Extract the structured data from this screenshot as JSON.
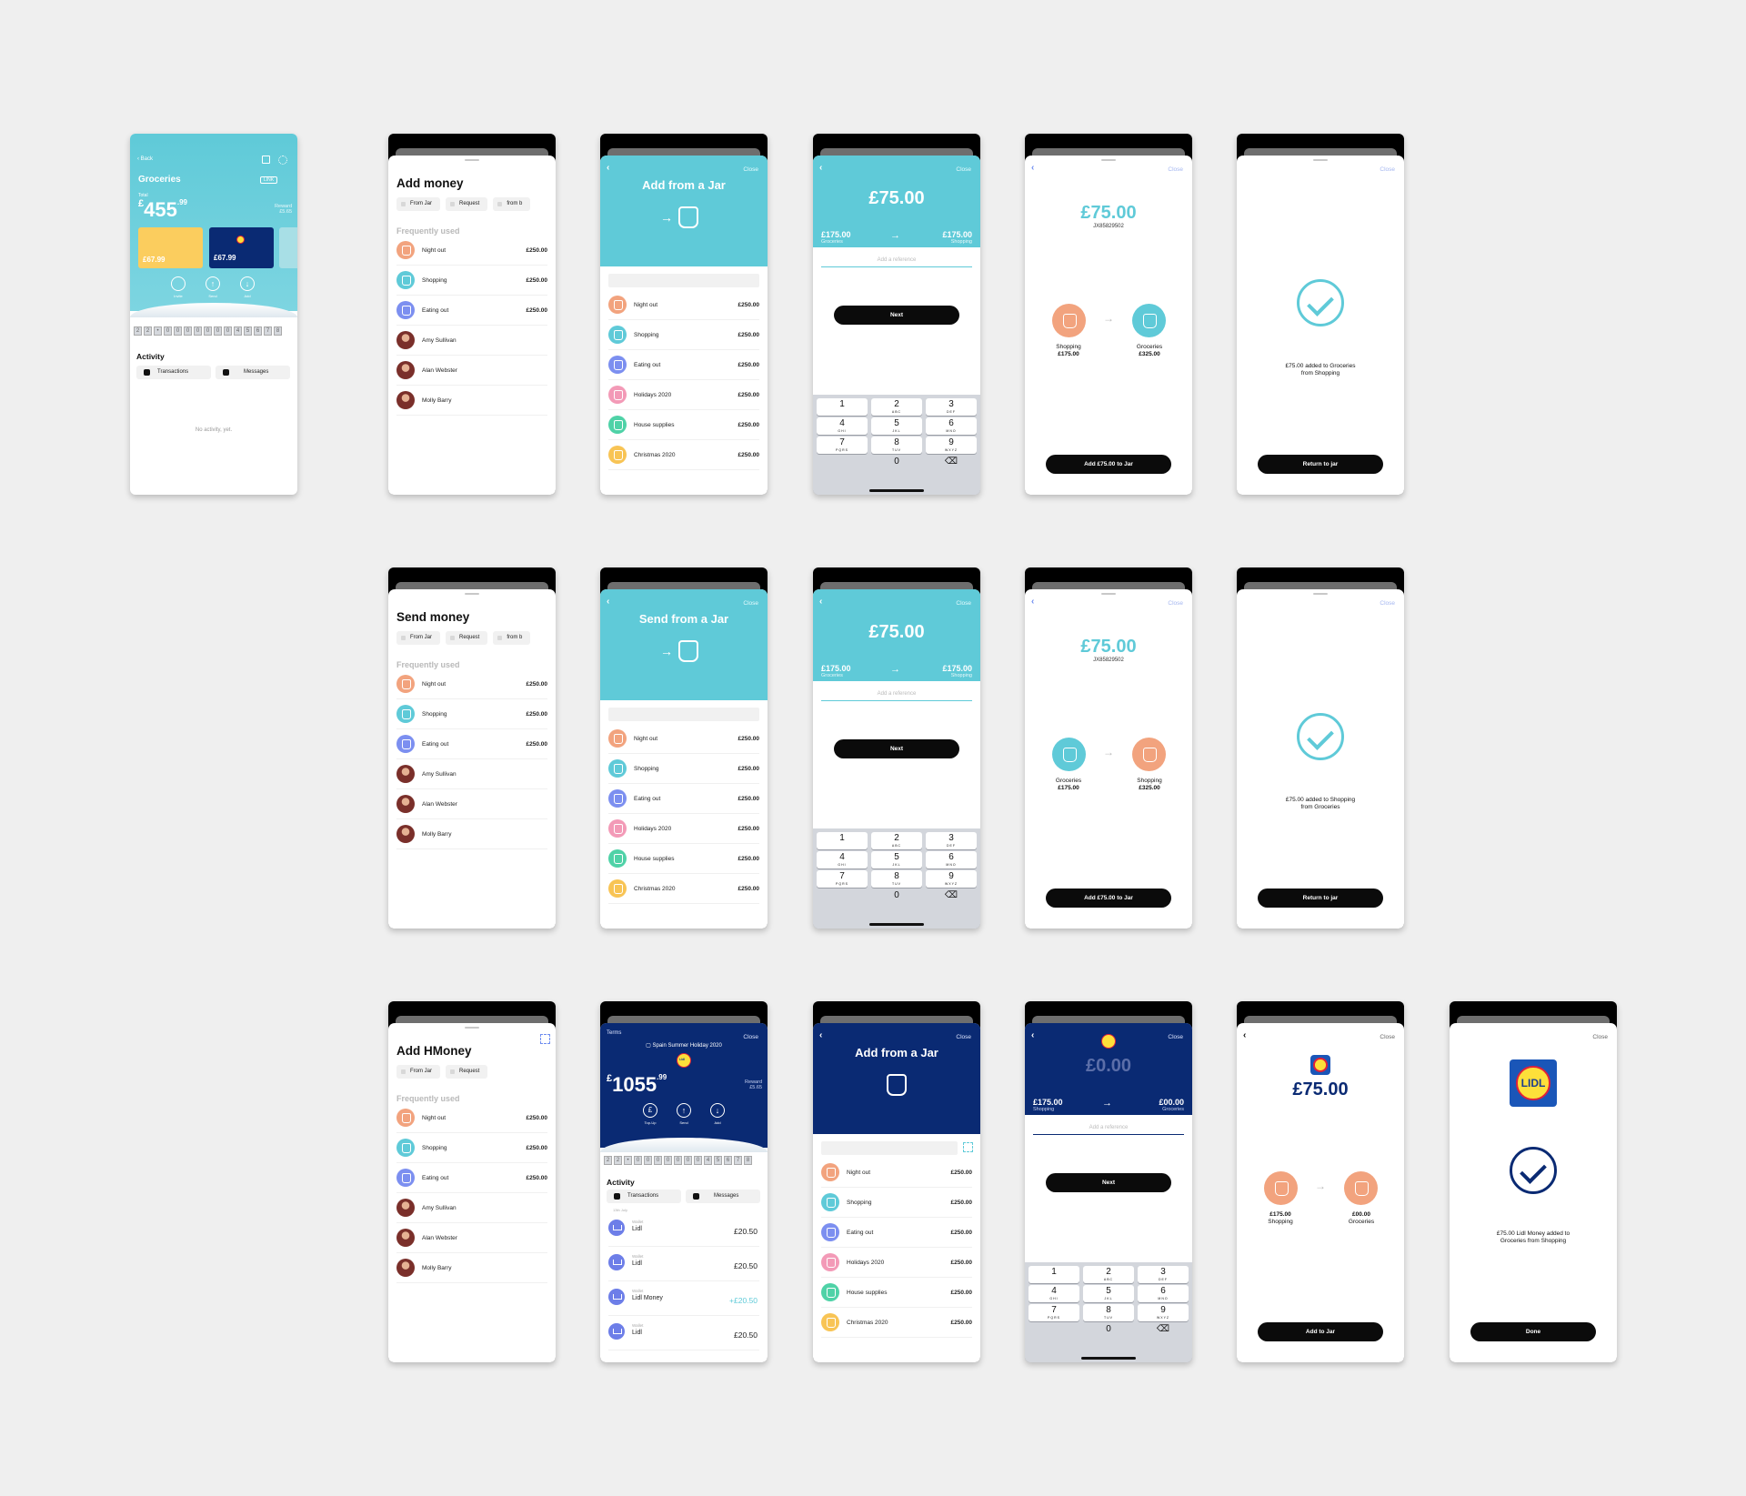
{
  "common": {
    "close": "Close",
    "frequently_used": "Frequently used",
    "from_jar": "From Jar",
    "request": "Request",
    "from_bank": "from b",
    "next": "Next",
    "reference_placeholder": "Add a reference",
    "jar_rows": [
      {
        "label": "Night out",
        "value": "£250.00",
        "color": "#f2a37e"
      },
      {
        "label": "Shopping",
        "value": "£250.00",
        "color": "#5fcad8"
      },
      {
        "label": "Eating out",
        "value": "£250.00",
        "color": "#7c8ff0"
      },
      {
        "label": "Holidays 2020",
        "value": "£250.00",
        "color": "#f39ab7"
      },
      {
        "label": "House supplies",
        "value": "£250.00",
        "color": "#4fd2a7"
      },
      {
        "label": "Christmas 2020",
        "value": "£250.00",
        "color": "#f8c455"
      }
    ],
    "contacts": [
      "Amy Sullivan",
      "Alan Webster",
      "Molly Barry"
    ],
    "keys": [
      {
        "n": "1",
        "l": ""
      },
      {
        "n": "2",
        "l": "ABC"
      },
      {
        "n": "3",
        "l": "DEF"
      },
      {
        "n": "4",
        "l": "GHI"
      },
      {
        "n": "5",
        "l": "JKL"
      },
      {
        "n": "6",
        "l": "MNO"
      },
      {
        "n": "7",
        "l": "PQRS"
      },
      {
        "n": "8",
        "l": "TUV"
      },
      {
        "n": "9",
        "l": "WXYZ"
      },
      {
        "n": "0",
        "l": ""
      }
    ],
    "ticket_digits": [
      "2",
      "2",
      "•",
      "0",
      "0",
      "0",
      "0",
      "0",
      "0",
      "0",
      "4",
      "5",
      "6",
      "7",
      "8"
    ]
  },
  "s1": {
    "back": "Back",
    "title": "Groceries",
    "link": "LINK",
    "total_label": "Total",
    "currency": "£",
    "amount": "455",
    "amount_dec": ".99",
    "reward_label": "Reward",
    "reward_value": "£5.65",
    "card1": "£67.99",
    "card2": "£67.99",
    "action_invite": "Invite",
    "action_send": "Send",
    "action_add": "Add",
    "activity": "Activity",
    "tab_transactions": "Transactions",
    "tab_messages": "Messages",
    "empty": "No activity, yet."
  },
  "s2": {
    "title": "Add money"
  },
  "s3": {
    "title": "Add from a Jar"
  },
  "s4": {
    "amount": "£75.00",
    "from_value": "£175.00",
    "from_label": "Groceries",
    "to_value": "£175.00",
    "to_label": "Shopping"
  },
  "s5": {
    "amount": "£75.00",
    "ref": "JX85829502",
    "from_label": "Shopping",
    "from_value": "£175.00",
    "to_label": "Groceries",
    "to_value": "£325.00",
    "button": "Add £75.00 to Jar"
  },
  "s6": {
    "message1": "£75.00 added to Groceries",
    "message2": "from Shopping",
    "button": "Return to jar"
  },
  "s7": {
    "title": "Send money"
  },
  "s8": {
    "title": "Send from a Jar"
  },
  "s9": {
    "amount": "£75.00",
    "from_value": "£175.00",
    "from_label": "Groceries",
    "to_value": "£175.00",
    "to_label": "Shopping"
  },
  "s10": {
    "amount": "£75.00",
    "ref": "JX85829502",
    "from_label": "Groceries",
    "from_value": "£175.00",
    "to_label": "Shopping",
    "to_value": "£325.00",
    "button": "Add £75.00 to Jar"
  },
  "s11": {
    "message1": "£75.00 added to Shopping",
    "message2": "from Groceries",
    "button": "Return to jar"
  },
  "s12": {
    "title": "Add HMoney"
  },
  "s13": {
    "terms": "Terms",
    "jar_name": "Spain Summer Holiday 2020",
    "logo_text": "Lidl",
    "currency": "£",
    "amount": "1055",
    "amount_dec": ".99",
    "reward_label": "Reward",
    "reward_value": "£5.65",
    "action_topup": "Top-Up",
    "action_send": "Send",
    "action_add": "Add",
    "activity": "Activity",
    "tab_transactions": "Transactions",
    "tab_messages": "Messages",
    "date": "13th July",
    "tx": [
      {
        "sub": "Wallet",
        "label": "Lidl",
        "value": "£20.50",
        "pos": false
      },
      {
        "sub": "Wallet",
        "label": "Lidl",
        "value": "£20.50",
        "pos": false
      },
      {
        "sub": "Wallet",
        "label": "Lidl Money",
        "value": "+£20.50",
        "pos": true
      },
      {
        "sub": "Wallet",
        "label": "Lidl",
        "value": "£20.50",
        "pos": false
      }
    ]
  },
  "s14": {
    "title": "Add from a Jar"
  },
  "s15": {
    "amount": "£0.00",
    "from_value": "£175.00",
    "from_label": "Shopping",
    "to_value": "£00.00",
    "to_label": "Groceries"
  },
  "s16": {
    "amount": "£75.00",
    "from_value": "£175.00",
    "from_label": "Shopping",
    "to_value": "£00.00",
    "to_label": "Groceries",
    "button": "Add to Jar"
  },
  "s17": {
    "logo_text": "LIDL",
    "message1": "£75.00 Lidl Money added to",
    "message2": "Groceries from Shopping",
    "button": "Done"
  },
  "colors": {
    "teal": "#5fcad8",
    "navy": "#0a2a73",
    "salmon": "#f2a37e",
    "positive": "#5fcad8"
  }
}
